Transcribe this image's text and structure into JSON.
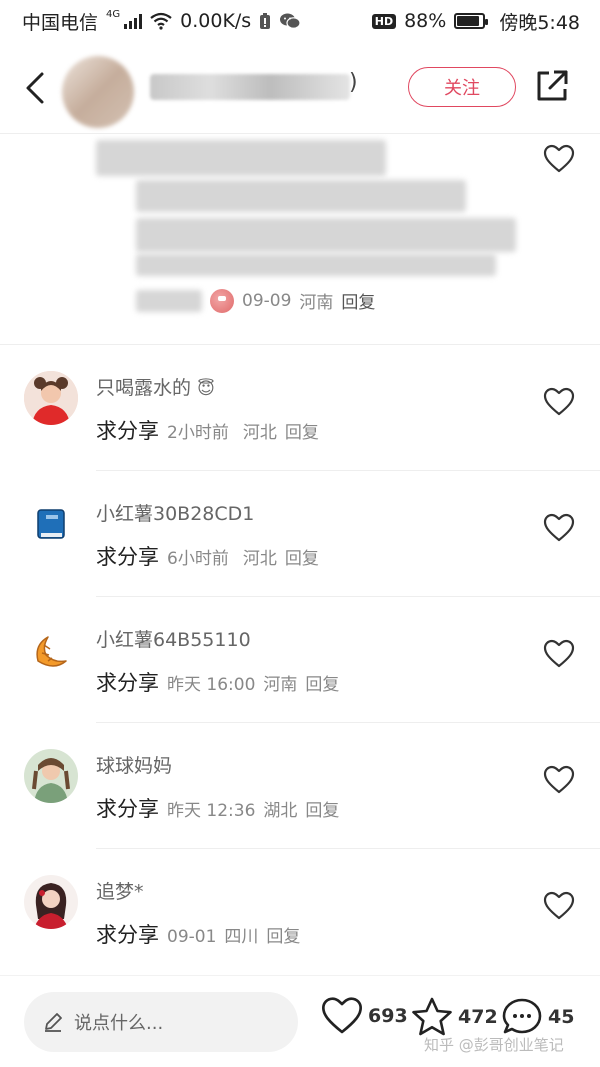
{
  "status_bar": {
    "carrier": "中国电信",
    "network_tag": "4G",
    "speed": "0.00K/s",
    "hd": "HD",
    "battery": "88%",
    "battery_level": 0.88,
    "time": "傍晚5:48"
  },
  "header": {
    "name_suffix": ")",
    "follow_label": "关注"
  },
  "top_comment": {
    "date": "09-09",
    "location": "河南",
    "reply_label": "回复"
  },
  "comments": [
    {
      "name": "只喝露水的",
      "text": "求分享",
      "time": "2小时前",
      "location": "河北",
      "reply": "回复"
    },
    {
      "name": "小红薯30B28CD1",
      "text": "求分享",
      "time": "6小时前",
      "location": "河北",
      "reply": "回复"
    },
    {
      "name": "小红薯64B55110",
      "text": "求分享",
      "time": "昨天 16:00",
      "location": "河南",
      "reply": "回复"
    },
    {
      "name": "球球妈妈",
      "text": "求分享",
      "time": "昨天 12:36",
      "location": "湖北",
      "reply": "回复"
    },
    {
      "name": "追梦*",
      "text": "求分享",
      "time": "09-01",
      "location": "四川",
      "reply": "回复"
    }
  ],
  "bottom_bar": {
    "input_placeholder": "说点什么...",
    "likes": "693",
    "collects": "472",
    "comments": "45",
    "watermark": "知乎 @彭哥创业笔记"
  },
  "colors": {
    "accent": "#e04860",
    "text_primary": "#222222",
    "text_secondary": "#888888"
  }
}
